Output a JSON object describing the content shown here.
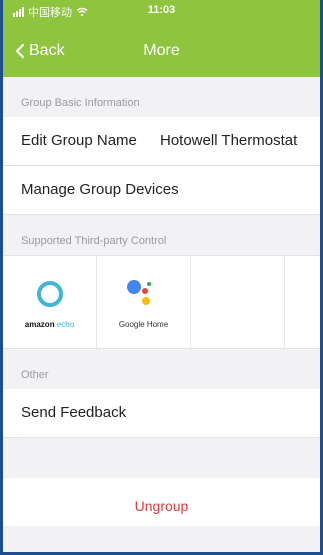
{
  "status_bar": {
    "carrier": "中国移动",
    "time": "11:03"
  },
  "nav": {
    "back_label": "Back",
    "title": "More"
  },
  "sections": {
    "basic": {
      "header": "Group Basic Information",
      "edit_group_name_label": "Edit Group Name",
      "edit_group_name_value": "Hotowell Thermostat",
      "manage_devices_label": "Manage Group Devices"
    },
    "third_party": {
      "header": "Supported Third-party Control",
      "items": [
        {
          "brand": "amazon",
          "product": "echo",
          "icon": "amazon-echo-icon"
        },
        {
          "label": "Google Home",
          "icon": "google-assistant-icon"
        }
      ]
    },
    "other": {
      "header": "Other",
      "send_feedback_label": "Send Feedback"
    }
  },
  "ungroup_label": "Ungroup",
  "colors": {
    "topbar": "#8fc43f",
    "danger": "#e03a3a",
    "frame": "#1e4f8c"
  }
}
